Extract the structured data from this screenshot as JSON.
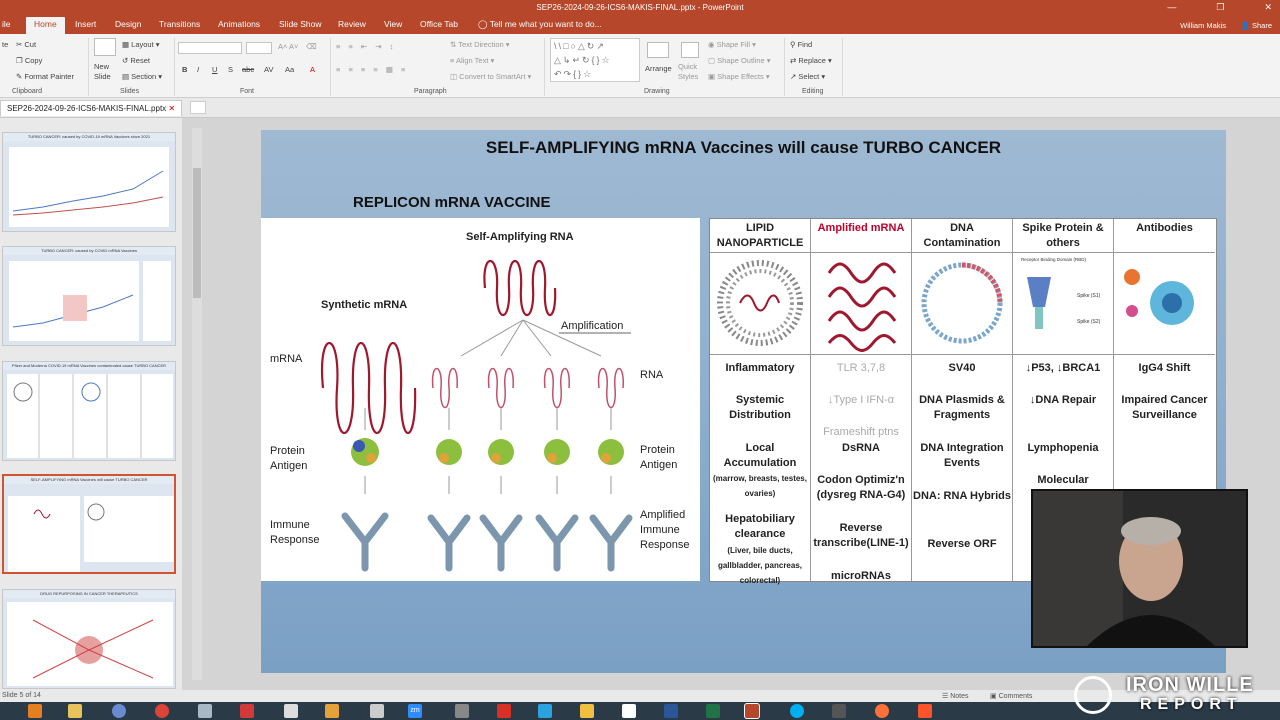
{
  "window": {
    "title": "SEP26-2024-09-26-ICS6-MAKIS-FINAL.pptx - PowerPoint"
  },
  "ribbon_tabs": [
    "Home",
    "Insert",
    "Design",
    "Transitions",
    "Animations",
    "Slide Show",
    "Review",
    "View",
    "Office Tab"
  ],
  "tell_me": "Tell me what you want to do...",
  "user": "William Makis",
  "share": "Share",
  "clipboard": {
    "cut": "Cut",
    "copy": "Copy",
    "format_painter": "Format Painter",
    "label": "Clipboard"
  },
  "slides_group": {
    "new_slide": "New Slide",
    "layout": "Layout",
    "reset": "Reset",
    "section": "Section",
    "label": "Slides"
  },
  "font_group": {
    "label": "Font",
    "buttons": [
      "B",
      "I",
      "U",
      "S",
      "abc",
      "AV",
      "Aa",
      "A"
    ]
  },
  "paragraph_group": {
    "label": "Paragraph",
    "text_direction": "Text Direction",
    "align_text": "Align Text",
    "smartart": "Convert to SmartArt"
  },
  "drawing_group": {
    "label": "Drawing",
    "arrange": "Arrange",
    "quick_styles": "Quick Styles",
    "shape_fill": "Shape Fill",
    "shape_outline": "Shape Outline",
    "shape_effects": "Shape Effects"
  },
  "editing_group": {
    "label": "Editing",
    "find": "Find",
    "replace": "Replace",
    "select": "Select"
  },
  "file_tab": "SEP26-2024-09-26-ICS6-MAKIS-FINAL.pptx",
  "thumbnails": [
    {
      "title": "TURBO CANCER: caused by COVID-19 mRNA Vaccines since 2021"
    },
    {
      "title": "TURBO CANCER: caused by COVID mRNA Vaccines"
    },
    {
      "title": "Pfizer and Moderna COVID-19 mRNA Vaccines contaminated cause TURBO CANCER"
    },
    {
      "title": "SELF-AMPLIFYING mRNA Vaccines will cause TURBO CANCER"
    },
    {
      "title": "DRUG REPURPOSING IN CANCER THERAPEUTICS"
    }
  ],
  "slide": {
    "title": "SELF-AMPLIFYING mRNA Vaccines will cause TURBO CANCER",
    "replicon": "REPLICON mRNA VACCINE",
    "diagram": {
      "synthetic": "Synthetic mRNA",
      "self_amp": "Self-Amplifying RNA",
      "amplification": "Amplification",
      "mrna": "mRNA",
      "rna": "RNA",
      "protein_antigen": "Protein Antigen",
      "protein_antigen_r": "Protein Antigen",
      "immune_response": "Immune Response",
      "amplified_immune": "Amplified Immune Response"
    },
    "table": {
      "headers": [
        "LIPID NANOPARTICLE",
        "Amplified mRNA",
        "DNA Contamination",
        "Spike Protein & others",
        "Antibodies"
      ],
      "col1": [
        "Inflammatory",
        "Systemic Distribution",
        "Local Accumulation",
        "(marrow, breasts, testes, ovaries)",
        "Hepatobiliary clearance",
        "(Liver, bile ducts, gallbladder, pancreas, colorectal)"
      ],
      "col2": [
        "TLR 3,7,8",
        "↓Type I IFN-α",
        "Frameshift ptns",
        "DsRNA",
        "Codon Optimiz'n (dysreg RNA-G4)",
        "Reverse transcribe(LINE-1)",
        "microRNAs"
      ],
      "col3": [
        "SV40",
        "DNA Plasmids & Fragments",
        "DNA Integration Events",
        "DNA: RNA Hybrids",
        "Reverse ORF"
      ],
      "col4": [
        "↓P53, ↓BRCA1",
        "↓DNA Repair",
        "Lymphopenia",
        "Molecular"
      ],
      "col5": [
        "IgG4 Shift",
        "Impaired Cancer Surveillance"
      ],
      "spike_img_labels": [
        "Receptor Binding Domain (RBD)",
        "Spike (S1)",
        "Spike (S2)"
      ]
    }
  },
  "status": {
    "slide_num": "Slide 5 of 14",
    "notes": "Notes",
    "comments": "Comments"
  },
  "watermark": {
    "line1": "IRON WILLE",
    "line2": "REPORT"
  },
  "colors": {
    "accent": "#b7472a",
    "red_header": "#c0002a"
  }
}
